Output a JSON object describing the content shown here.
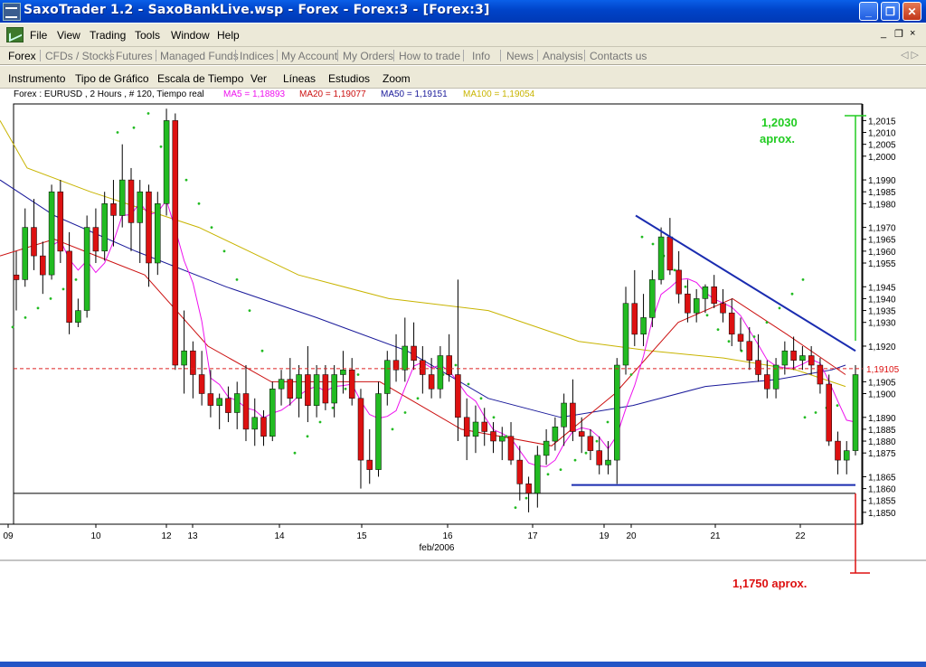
{
  "window": {
    "title": "SaxoTrader 1.2 - SaxoBankLive.wsp - Forex - Forex:3 - [Forex:3]",
    "icon": "saxo-app-icon",
    "controls": [
      "_",
      "❐",
      "✕"
    ]
  },
  "menu": {
    "items": [
      "File",
      "View",
      "Trading",
      "Tools",
      "Window",
      "Help"
    ],
    "mdi_controls": [
      "_",
      "❐",
      "×"
    ]
  },
  "nav": {
    "items": [
      "Forex",
      "CFDs / Stocks",
      "Futures",
      "Managed Funds",
      "Indices",
      "My Account",
      "My Orders",
      "How to trade",
      "Info",
      "News",
      "Analysis",
      "Contacts us"
    ],
    "active": "Forex",
    "arrows": "◁ ▷"
  },
  "chart_toolbar": {
    "items": [
      "Instrumento",
      "Tipo de Gráfico",
      "Escala de Tiempo",
      "Ver",
      "Líneas",
      "Estudios",
      "Zoom"
    ]
  },
  "legend": {
    "instrument": "Forex : EURUSD , 2 Hours , # 120, Tiempo real",
    "ma5": "MA5 = 1,18893",
    "ma20": "MA20 = 1,19077",
    "ma50": "MA50 = 1,19151",
    "ma100": "MA100 = 1,19054"
  },
  "colors": {
    "bull": "#22bb22",
    "bear": "#dd1111",
    "ma5": "#ee11ee",
    "ma20": "#cc1111",
    "ma50": "#1a1a9a",
    "ma100": "#c8b400",
    "sar": "#22bb22",
    "trendline": "#1a2cb0",
    "annotation_green": "#22cc22",
    "annotation_red": "#dd1111"
  },
  "chart_data": {
    "type": "candlestick",
    "instrument": "EURUSD",
    "timeframe": "2 Hours",
    "ylim": [
      1.1845,
      1.2022
    ],
    "y_ticks": [
      "1,2015",
      "1,2010",
      "1,2005",
      "1,2000",
      "1,1990",
      "1,1985",
      "1,1980",
      "1,1970",
      "1,1965",
      "1,1960",
      "1,1955",
      "1,1945",
      "1,1940",
      "1,1935",
      "1,1930",
      "1,1920",
      "1,1905",
      "1,1900",
      "1,1890",
      "1,1885",
      "1,1880",
      "1,1875",
      "1,1865",
      "1,1860",
      "1,1855",
      "1,1850"
    ],
    "x_ticks": [
      "09",
      "10",
      "12",
      "13",
      "14",
      "15",
      "16",
      "17",
      "19",
      "20",
      "21",
      "22"
    ],
    "x_label": "feb/2006",
    "current_price": "1,19105",
    "current_price_value": 1.19105,
    "candles": [
      [
        1.195,
        1.196,
        1.1935,
        1.1948
      ],
      [
        1.1948,
        1.1978,
        1.1945,
        1.197
      ],
      [
        1.197,
        1.1982,
        1.1952,
        1.1958
      ],
      [
        1.1958,
        1.1964,
        1.1942,
        1.195
      ],
      [
        1.195,
        1.1988,
        1.1948,
        1.1985
      ],
      [
        1.1985,
        1.199,
        1.1955,
        1.196
      ],
      [
        1.196,
        1.1968,
        1.1925,
        1.193
      ],
      [
        1.193,
        1.194,
        1.1928,
        1.1935
      ],
      [
        1.1935,
        1.1975,
        1.1932,
        1.197
      ],
      [
        1.197,
        1.1978,
        1.1955,
        1.196
      ],
      [
        1.196,
        1.1985,
        1.1956,
        1.198
      ],
      [
        1.198,
        1.199,
        1.1962,
        1.1975
      ],
      [
        1.1975,
        1.2005,
        1.197,
        1.199
      ],
      [
        1.199,
        1.1995,
        1.196,
        1.1972
      ],
      [
        1.1972,
        1.199,
        1.1955,
        1.1985
      ],
      [
        1.1985,
        1.1988,
        1.1945,
        1.1955
      ],
      [
        1.1955,
        1.1985,
        1.195,
        1.198
      ],
      [
        1.198,
        1.202,
        1.1975,
        1.2015
      ],
      [
        1.2015,
        1.2018,
        1.191,
        1.1912
      ],
      [
        1.1912,
        1.1935,
        1.19,
        1.1918
      ],
      [
        1.1918,
        1.1922,
        1.1898,
        1.1908
      ],
      [
        1.1908,
        1.1918,
        1.1895,
        1.19
      ],
      [
        1.19,
        1.191,
        1.189,
        1.1895
      ],
      [
        1.1895,
        1.19,
        1.1885,
        1.1898
      ],
      [
        1.1898,
        1.1903,
        1.1888,
        1.1892
      ],
      [
        1.1892,
        1.1905,
        1.1885,
        1.19
      ],
      [
        1.19,
        1.1912,
        1.188,
        1.1885
      ],
      [
        1.1885,
        1.1898,
        1.1878,
        1.189
      ],
      [
        1.189,
        1.1893,
        1.1878,
        1.1882
      ],
      [
        1.1882,
        1.1905,
        1.188,
        1.1902
      ],
      [
        1.1902,
        1.191,
        1.1895,
        1.1906
      ],
      [
        1.1906,
        1.1915,
        1.1895,
        1.1898
      ],
      [
        1.1898,
        1.1912,
        1.189,
        1.1908
      ],
      [
        1.1908,
        1.192,
        1.1888,
        1.1895
      ],
      [
        1.1895,
        1.1912,
        1.189,
        1.1908
      ],
      [
        1.1908,
        1.1912,
        1.1893,
        1.1896
      ],
      [
        1.1896,
        1.1912,
        1.189,
        1.1908
      ],
      [
        1.1908,
        1.1918,
        1.19,
        1.191
      ],
      [
        1.191,
        1.1915,
        1.1895,
        1.1898
      ],
      [
        1.1898,
        1.1902,
        1.186,
        1.1872
      ],
      [
        1.1872,
        1.1885,
        1.1862,
        1.1868
      ],
      [
        1.1868,
        1.1905,
        1.1865,
        1.19
      ],
      [
        1.19,
        1.1918,
        1.1895,
        1.1914
      ],
      [
        1.1914,
        1.1925,
        1.1905,
        1.191
      ],
      [
        1.191,
        1.1932,
        1.1905,
        1.192
      ],
      [
        1.192,
        1.193,
        1.191,
        1.1914
      ],
      [
        1.1914,
        1.192,
        1.19,
        1.1908
      ],
      [
        1.1908,
        1.1915,
        1.1898,
        1.1902
      ],
      [
        1.1902,
        1.192,
        1.1898,
        1.1916
      ],
      [
        1.1916,
        1.1925,
        1.1905,
        1.1908
      ],
      [
        1.1908,
        1.1948,
        1.188,
        1.189
      ],
      [
        1.189,
        1.1898,
        1.1872,
        1.1882
      ],
      [
        1.1882,
        1.1895,
        1.1875,
        1.1888
      ],
      [
        1.1888,
        1.1894,
        1.1878,
        1.1884
      ],
      [
        1.1884,
        1.1888,
        1.1875,
        1.188
      ],
      [
        1.188,
        1.1886,
        1.1872,
        1.1882
      ],
      [
        1.1882,
        1.1888,
        1.187,
        1.1872
      ],
      [
        1.1872,
        1.1878,
        1.1855,
        1.1862
      ],
      [
        1.1862,
        1.1865,
        1.185,
        1.1858
      ],
      [
        1.1858,
        1.1878,
        1.1852,
        1.1874
      ],
      [
        1.1874,
        1.1885,
        1.187,
        1.188
      ],
      [
        1.188,
        1.189,
        1.1876,
        1.1886
      ],
      [
        1.1886,
        1.19,
        1.1878,
        1.1896
      ],
      [
        1.1896,
        1.1906,
        1.188,
        1.1884
      ],
      [
        1.1884,
        1.189,
        1.1875,
        1.1882
      ],
      [
        1.1882,
        1.1885,
        1.1872,
        1.1876
      ],
      [
        1.1876,
        1.1882,
        1.1866,
        1.187
      ],
      [
        1.187,
        1.188,
        1.1866,
        1.1872
      ],
      [
        1.1872,
        1.1915,
        1.1862,
        1.1912
      ],
      [
        1.1912,
        1.1945,
        1.1908,
        1.1938
      ],
      [
        1.1938,
        1.1952,
        1.192,
        1.1925
      ],
      [
        1.1925,
        1.1942,
        1.192,
        1.1932
      ],
      [
        1.1932,
        1.1952,
        1.1928,
        1.1948
      ],
      [
        1.1948,
        1.197,
        1.1946,
        1.1966
      ],
      [
        1.1966,
        1.1974,
        1.195,
        1.1952
      ],
      [
        1.1952,
        1.196,
        1.1938,
        1.1942
      ],
      [
        1.1942,
        1.1948,
        1.193,
        1.1934
      ],
      [
        1.1934,
        1.1944,
        1.193,
        1.194
      ],
      [
        1.194,
        1.1946,
        1.1934,
        1.1945
      ],
      [
        1.1945,
        1.195,
        1.1936,
        1.1938
      ],
      [
        1.1938,
        1.1944,
        1.193,
        1.1934
      ],
      [
        1.1934,
        1.194,
        1.192,
        1.1925
      ],
      [
        1.1925,
        1.1932,
        1.1918,
        1.1922
      ],
      [
        1.1922,
        1.1928,
        1.191,
        1.1914
      ],
      [
        1.1914,
        1.1925,
        1.1905,
        1.1908
      ],
      [
        1.1908,
        1.1914,
        1.1898,
        1.1902
      ],
      [
        1.1902,
        1.1915,
        1.1898,
        1.1912
      ],
      [
        1.1912,
        1.1922,
        1.1908,
        1.1918
      ],
      [
        1.1918,
        1.1924,
        1.191,
        1.1914
      ],
      [
        1.1914,
        1.192,
        1.191,
        1.1916
      ],
      [
        1.1916,
        1.192,
        1.1908,
        1.1912
      ],
      [
        1.1912,
        1.1915,
        1.19,
        1.1904
      ],
      [
        1.1904,
        1.1908,
        1.1878,
        1.188
      ],
      [
        1.188,
        1.1884,
        1.1866,
        1.1872
      ],
      [
        1.1872,
        1.188,
        1.1866,
        1.1876
      ],
      [
        1.1876,
        1.1912,
        1.1874,
        1.1908
      ]
    ],
    "ma100": [
      [
        0,
        1.2015
      ],
      [
        30,
        1.1995
      ],
      [
        100,
        1.1985
      ],
      [
        220,
        1.197
      ],
      [
        330,
        1.195
      ],
      [
        430,
        1.194
      ],
      [
        540,
        1.1935
      ],
      [
        640,
        1.1922
      ],
      [
        720,
        1.1918
      ],
      [
        800,
        1.1915
      ],
      [
        880,
        1.191
      ],
      [
        935,
        1.1903
      ]
    ],
    "ma50": [
      [
        0,
        1.199
      ],
      [
        60,
        1.1975
      ],
      [
        150,
        1.196
      ],
      [
        250,
        1.1945
      ],
      [
        350,
        1.1932
      ],
      [
        450,
        1.1918
      ],
      [
        540,
        1.1898
      ],
      [
        620,
        1.189
      ],
      [
        700,
        1.1895
      ],
      [
        780,
        1.1903
      ],
      [
        860,
        1.1906
      ],
      [
        920,
        1.191
      ],
      [
        935,
        1.1912
      ]
    ],
    "ma20": [
      [
        0,
        1.1958
      ],
      [
        60,
        1.1965
      ],
      [
        160,
        1.195
      ],
      [
        230,
        1.192
      ],
      [
        300,
        1.1905
      ],
      [
        420,
        1.1905
      ],
      [
        510,
        1.1885
      ],
      [
        610,
        1.1878
      ],
      [
        680,
        1.19
      ],
      [
        750,
        1.193
      ],
      [
        810,
        1.194
      ],
      [
        870,
        1.1925
      ],
      [
        935,
        1.1908
      ]
    ],
    "sar": [
      [
        14,
        1.1928
      ],
      [
        28,
        1.1932
      ],
      [
        42,
        1.1936
      ],
      [
        56,
        1.194
      ],
      [
        70,
        1.1944
      ],
      [
        84,
        1.1948
      ],
      [
        98,
        1.1952
      ],
      [
        130,
        1.201
      ],
      [
        148,
        1.2012
      ],
      [
        164,
        1.2018
      ],
      [
        178,
        1.2004
      ],
      [
        192,
        1.1998
      ],
      [
        206,
        1.199
      ],
      [
        220,
        1.198
      ],
      [
        234,
        1.197
      ],
      [
        248,
        1.196
      ],
      [
        262,
        1.1948
      ],
      [
        276,
        1.1935
      ],
      [
        290,
        1.1918
      ],
      [
        326,
        1.1875
      ],
      [
        340,
        1.1882
      ],
      [
        354,
        1.1888
      ],
      [
        368,
        1.1894
      ],
      [
        382,
        1.1902
      ],
      [
        396,
        1.1908
      ],
      [
        420,
        1.1878
      ],
      [
        434,
        1.1885
      ],
      [
        448,
        1.1892
      ],
      [
        462,
        1.1898
      ],
      [
        476,
        1.1904
      ],
      [
        490,
        1.1908
      ],
      [
        504,
        1.1912
      ],
      [
        518,
        1.1904
      ],
      [
        532,
        1.1898
      ],
      [
        546,
        1.189
      ],
      [
        560,
        1.1882
      ],
      [
        570,
        1.1852
      ],
      [
        582,
        1.1856
      ],
      [
        594,
        1.186
      ],
      [
        606,
        1.1866
      ],
      [
        620,
        1.1868
      ],
      [
        636,
        1.1872
      ],
      [
        648,
        1.1875
      ],
      [
        660,
        1.188
      ],
      [
        672,
        1.1888
      ],
      [
        684,
        1.1896
      ],
      [
        698,
        1.1908
      ],
      [
        710,
        1.1966
      ],
      [
        722,
        1.1963
      ],
      [
        734,
        1.1958
      ],
      [
        746,
        1.1952
      ],
      [
        758,
        1.1945
      ],
      [
        770,
        1.1939
      ],
      [
        782,
        1.1933
      ],
      [
        794,
        1.1927
      ],
      [
        806,
        1.1922
      ],
      [
        820,
        1.1918
      ],
      [
        834,
        1.1924
      ],
      [
        848,
        1.193
      ],
      [
        862,
        1.1936
      ],
      [
        876,
        1.1942
      ],
      [
        888,
        1.1948
      ],
      [
        890,
        1.189
      ],
      [
        902,
        1.1892
      ],
      [
        914,
        1.1894
      ],
      [
        926,
        1.1895
      ]
    ],
    "trendline_top": [
      [
        703,
        1.1975
      ],
      [
        946,
        1.1918
      ]
    ],
    "support_line": [
      [
        632,
        1.18615
      ],
      [
        946,
        1.18615
      ]
    ],
    "left_support_line": [
      [
        15,
        1.1858
      ],
      [
        946,
        1.1858
      ]
    ],
    "annotations": {
      "target_up": "1,2030",
      "target_up_note": "aprox.",
      "target_down": "1,1750 aprox."
    }
  }
}
